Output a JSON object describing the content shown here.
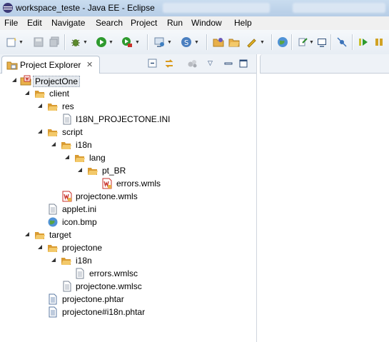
{
  "window": {
    "title": "workspace_teste - Java EE - Eclipse"
  },
  "menu": [
    "File",
    "Edit",
    "Navigate",
    "Search",
    "Project",
    "Run",
    "Window",
    "Help"
  ],
  "view": {
    "tab_label": "Project Explorer",
    "close_glyph": "✕"
  },
  "tree": {
    "project": "ProjectOne",
    "client": "client",
    "res": "res",
    "i18n_ini": "I18N_PROJECTONE.INI",
    "script": "script",
    "script_i18n": "i18n",
    "lang": "lang",
    "pt_br": "pt_BR",
    "errors_wmls": "errors.wmls",
    "projectone_wmls": "projectone.wmls",
    "applet_ini": "applet.ini",
    "icon_bmp": "icon.bmp",
    "target": "target",
    "projectone_folder": "projectone",
    "target_i18n": "i18n",
    "errors_wmlsc": "errors.wmlsc",
    "projectone_wmlsc": "projectone.wmlsc",
    "projectone_phtar": "projectone.phtar",
    "projectone_i18n_phtar": "projectone#i18n.phtar"
  },
  "colors": {
    "folder": "#e8b04a",
    "title_bar": "#c9dcef",
    "accent": "#3b73b9"
  }
}
